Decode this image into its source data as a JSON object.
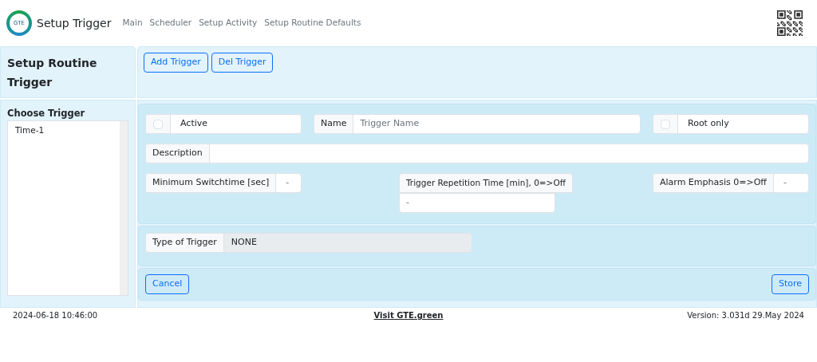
{
  "navbar": {
    "logo_text": "GTE",
    "title": "Setup Trigger",
    "links": [
      "Main",
      "Scheduler",
      "Setup Activity",
      "Setup Routine Defaults"
    ]
  },
  "sidebar": {
    "heading": "Setup Routine Trigger",
    "list_title": "Choose Trigger",
    "items": [
      {
        "label": "Time-1",
        "selected": false
      }
    ]
  },
  "toolbar": {
    "buttons": [
      "Add Trigger",
      "Del Trigger"
    ]
  },
  "form": {
    "active": {
      "label": "Active",
      "checked": false
    },
    "name": {
      "label": "Name",
      "placeholder": "Trigger Name"
    },
    "root_only": {
      "label": "Root only",
      "checked": false
    },
    "description": {
      "label": "Description"
    },
    "min_switchtime": {
      "label": "Minimum Switchtime [sec]",
      "value": "-"
    },
    "repetition": {
      "label": "Trigger Repetition Time [min], 0=>Off",
      "value": "-"
    },
    "alarm": {
      "label": "Alarm Emphasis 0=>Off",
      "value": "-"
    },
    "type": {
      "label": "Type of Trigger",
      "value": "NONE",
      "disabled": true
    }
  },
  "actions": {
    "cancel": "Cancel",
    "store": "Store"
  },
  "footer": {
    "timestamp": "2024-06-18 10:46:00",
    "link": "Visit GTE.green",
    "version": "Version: 3.031d 29.May 2024"
  }
}
